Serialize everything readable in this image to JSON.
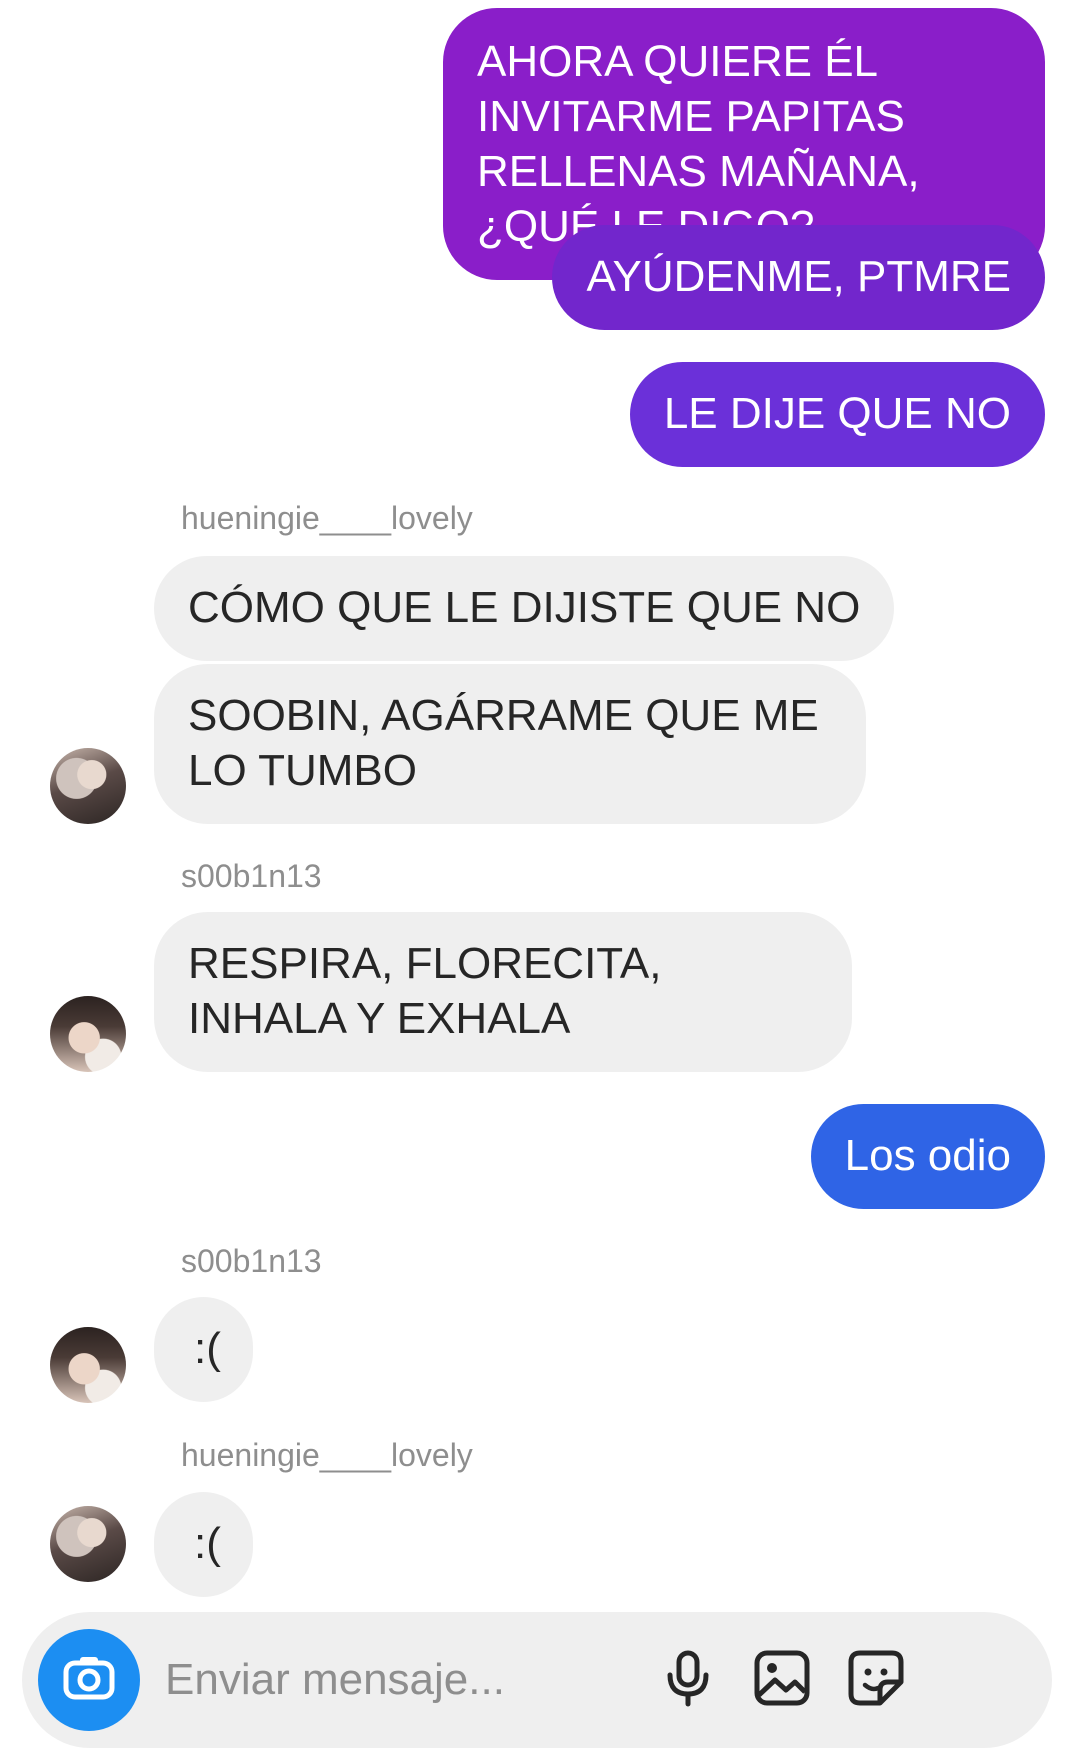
{
  "colors": {
    "outgoing_purple": "#8a1ec9",
    "outgoing_violet": "#7226cc",
    "outgoing_indigo": "#6b30d9",
    "outgoing_blue": "#2f64e6",
    "incoming_bg": "#efefef",
    "sender_name": "#8e8e8e",
    "camera_button": "#1c8ef2"
  },
  "messages": [
    {
      "direction": "out",
      "text": "AHORA QUIERE ÉL INVITARME PAPITAS RELLENAS MAÑANA, ¿QUÉ LE DIGO?"
    },
    {
      "direction": "out",
      "text": "AYÚDENME, PTMRE"
    },
    {
      "direction": "out",
      "text": "LE DIJE QUE NO"
    },
    {
      "direction": "in",
      "sender": "hueningie____lovely",
      "text": "CÓMO QUE LE DIJISTE QUE NO"
    },
    {
      "direction": "in",
      "text": "SOOBIN, AGÁRRAME QUE ME LO TUMBO"
    },
    {
      "direction": "in",
      "sender": "s00b1n13",
      "text": "RESPIRA, FLORECITA, INHALA Y EXHALA"
    },
    {
      "direction": "out",
      "text": "Los odio"
    },
    {
      "direction": "in",
      "sender": "s00b1n13",
      "text": ":("
    },
    {
      "direction": "in",
      "sender": "hueningie____lovely",
      "text": ":("
    }
  ],
  "composer": {
    "placeholder": "Enviar mensaje...",
    "icons": [
      "camera-icon",
      "microphone-icon",
      "image-icon",
      "sticker-icon"
    ]
  }
}
